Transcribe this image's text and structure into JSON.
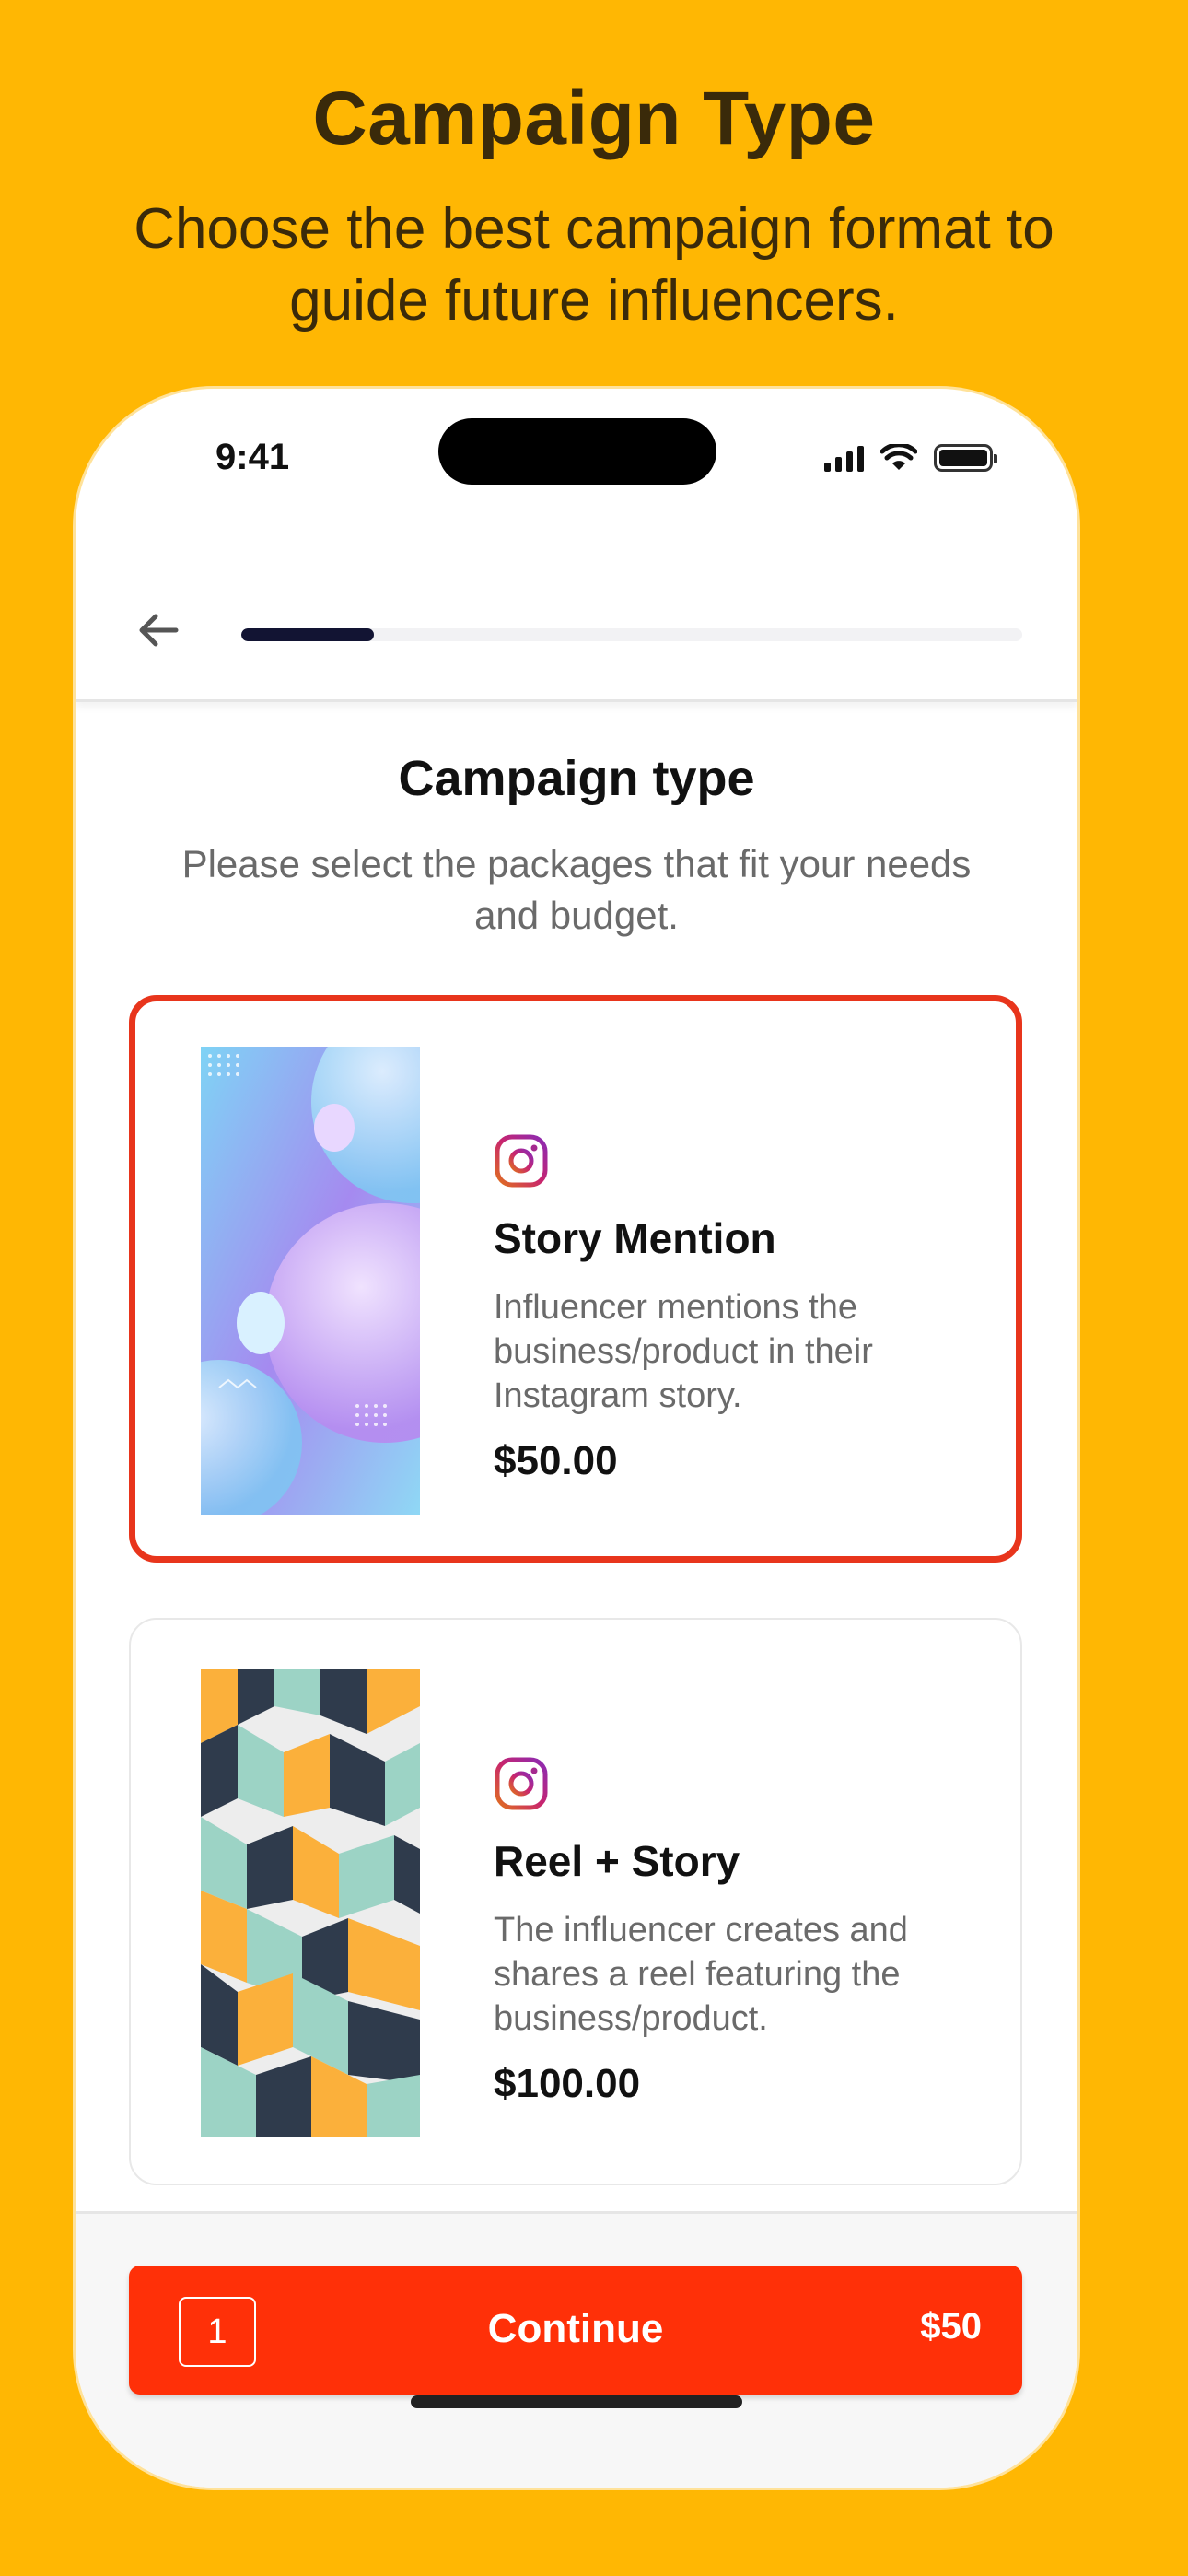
{
  "promo": {
    "title": "Campaign Type",
    "subtitle": "Choose the best campaign format to guide future influencers."
  },
  "status_bar": {
    "time": "9:41",
    "icons": [
      "cellular-signal-icon",
      "wifi-icon",
      "battery-icon"
    ]
  },
  "nav": {
    "back_icon": "arrow-left-icon",
    "progress_fraction": 0.17
  },
  "content": {
    "title": "Campaign type",
    "subtitle": "Please select the packages that fit your needs and budget."
  },
  "packages": [
    {
      "name": "Story Mention",
      "description": "Influencer mentions the business/product in their Instagram story.",
      "price": "$50.00",
      "platform_icon": "instagram-icon",
      "selected": true
    },
    {
      "name": "Reel + Story",
      "description": "The influencer creates and shares a reel featuring the business/product.",
      "price": "$100.00",
      "platform_icon": "instagram-icon",
      "selected": false
    }
  ],
  "cta": {
    "count": "1",
    "label": "Continue",
    "total": "$50"
  },
  "colors": {
    "background": "#FFB703",
    "accent": "#FF3008",
    "selected_border": "#E8351C",
    "progress": "#121433"
  }
}
